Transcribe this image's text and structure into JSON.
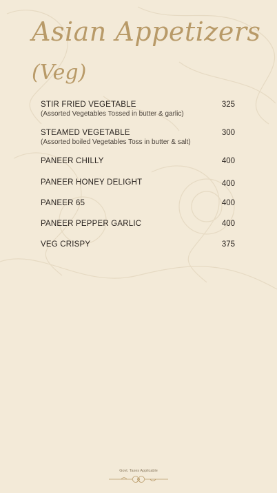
{
  "menu": {
    "title": "Asian Appetizers",
    "subtitle": "(Veg)",
    "items": [
      {
        "name": "STIR FRIED VEGETABLE",
        "desc": "(Assorted Vegetables  Tossed in butter & garlic)",
        "price": "325"
      },
      {
        "name": "STEAMED VEGETABLE",
        "desc": "(Assorted boiled Vegetables  Toss in butter & salt)",
        "price": "300"
      },
      {
        "name": "PANEER CHILLY",
        "desc": "",
        "price": "400"
      },
      {
        "name": "PANEER HONEY DELIGHT",
        "desc": "",
        "price": "400"
      },
      {
        "name": "PANEER 65",
        "desc": "",
        "price": "400"
      },
      {
        "name": "PANEER PEPPER GARLIC",
        "desc": "",
        "price": "400"
      },
      {
        "name": "VEG CRISPY",
        "desc": "",
        "price": "375"
      }
    ]
  },
  "footer": {
    "note": "Govt. Taxes Applicable"
  },
  "colors": {
    "background": "#f3ead8",
    "accent_gold": "#b89a68",
    "text": "#2a2420"
  }
}
